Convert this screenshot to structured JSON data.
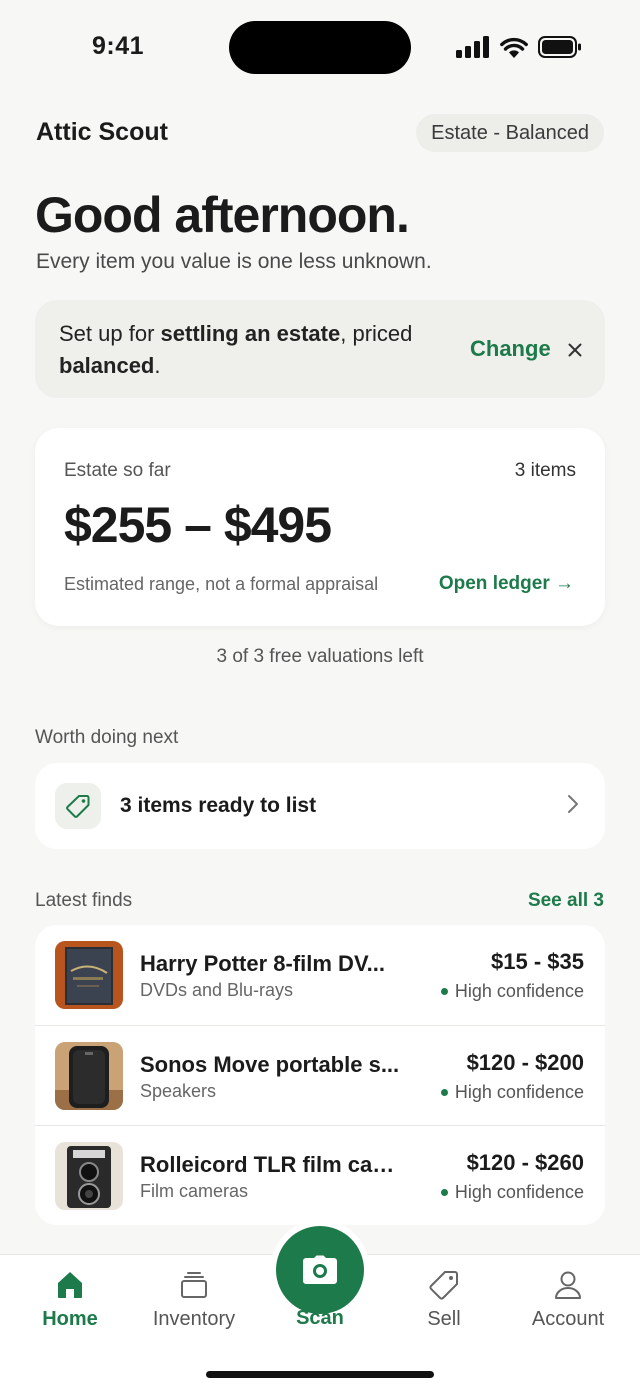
{
  "status_bar": {
    "time": "9:41"
  },
  "header": {
    "app_title": "Attic Scout",
    "mode_pill": "Estate - Balanced"
  },
  "greeting": {
    "title": "Good afternoon.",
    "tagline": "Every item you value is one less unknown."
  },
  "setup_banner": {
    "text_pre": "Set up for ",
    "text_bold_1": "settling an estate",
    "text_mid": ", priced ",
    "text_bold_2": "balanced",
    "text_post": ".",
    "change_label": "Change",
    "dismiss_icon": "close-icon"
  },
  "estate": {
    "label": "Estate so far",
    "count": "3 items",
    "range": "$255 – $495",
    "disclaimer": "Estimated range, not a formal appraisal",
    "ledger_link": "Open ledger →"
  },
  "free_valuations": "3 of 3 free valuations left",
  "worth_doing": {
    "section_label": "Worth doing next",
    "item_text": "3 items ready to list",
    "icon": "tag-icon"
  },
  "latest_finds": {
    "section_label": "Latest finds",
    "see_all": "See all 3",
    "items": [
      {
        "name": "Harry Potter 8-film DV...",
        "category": "DVDs and Blu-rays",
        "price": "$15 - $35",
        "confidence": "High confidence"
      },
      {
        "name": "Sonos Move portable s...",
        "category": "Speakers",
        "price": "$120 - $200",
        "confidence": "High confidence"
      },
      {
        "name": "Rolleicord TLR film cam...",
        "category": "Film cameras",
        "price": "$120 - $260",
        "confidence": "High confidence"
      }
    ]
  },
  "tab_bar": {
    "home": "Home",
    "inventory": "Inventory",
    "scan": "Scan",
    "sell": "Sell",
    "account": "Account"
  },
  "colors": {
    "accent": "#1d7a4a",
    "background": "#f7f7f5",
    "card": "#ffffff",
    "banner": "#efefeb"
  }
}
